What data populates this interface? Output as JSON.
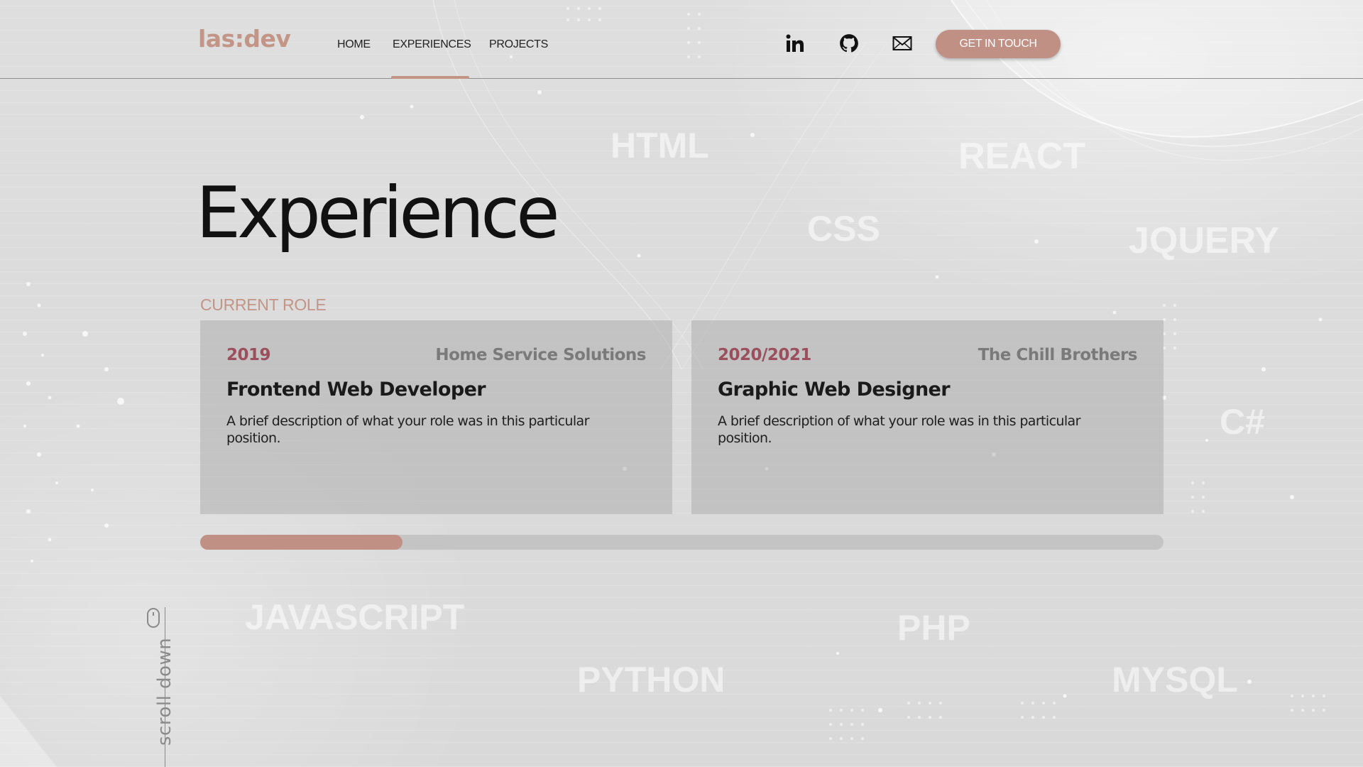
{
  "header": {
    "logo": "las:dev",
    "nav": [
      {
        "label": "HOME"
      },
      {
        "label": "EXPERIENCES"
      },
      {
        "label": "PROJECTS"
      }
    ],
    "active_nav": "EXPERIENCES",
    "social_icons": [
      "linkedin-icon",
      "github-icon",
      "mail-icon"
    ],
    "cta_label": "GET IN TOUCH"
  },
  "main": {
    "title": "Experience",
    "section_label": "CURRENT ROLE",
    "cards": [
      {
        "year": "2019",
        "company": "Home Service Solutions",
        "role": "Frontend Web Developer",
        "description": "A brief description of what your role was in this particular position."
      },
      {
        "year": "2020/2021",
        "company": "The Chill Brothers",
        "role": "Graphic Web Designer",
        "description": "A brief description of what your role was in this particular position."
      }
    ],
    "scroll_progress": 0.21
  },
  "background_words": [
    "HTML",
    "REACT",
    "CSS",
    "JQUERY",
    "C#",
    "JAVASCRIPT",
    "PHP",
    "PYTHON",
    "MYSQL"
  ],
  "scroll_hint": {
    "label": "scroll down",
    "icon": "mouse-icon"
  },
  "colors": {
    "accent": "#c29587",
    "year": "#9b4f5d",
    "background": "#dcdcdc"
  }
}
